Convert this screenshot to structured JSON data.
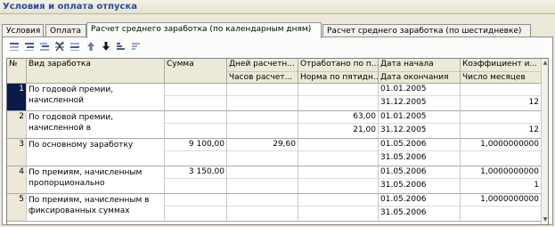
{
  "window": {
    "title": "Условия и оплата отпуска"
  },
  "tabs": [
    {
      "label": "Условия"
    },
    {
      "label": "Оплата"
    },
    {
      "label": "Расчет среднего заработка (по календарным дням)"
    },
    {
      "label": "Расчет среднего заработка (по шестидневке)"
    }
  ],
  "toolbar": {
    "buttons": [
      {
        "icon": "add-row-icon"
      },
      {
        "icon": "add-child-row-icon"
      },
      {
        "icon": "copy-row-icon"
      },
      {
        "icon": "delete-row-icon"
      },
      {
        "icon": "edit-row-icon"
      },
      {
        "icon": "move-up-icon"
      },
      {
        "icon": "move-down-icon"
      },
      {
        "icon": "sort-asc-icon"
      },
      {
        "icon": "sort-desc-icon"
      }
    ]
  },
  "table": {
    "columns": [
      {
        "l1": "№",
        "l2": ""
      },
      {
        "l1": "Вид заработка",
        "l2": ""
      },
      {
        "l1": "Сумма",
        "l2": ""
      },
      {
        "l1": "Дней расчетн...",
        "l2": "Часов расчет..."
      },
      {
        "l1": "Отработано по п...",
        "l2": "Норма по пятидн..."
      },
      {
        "l1": "Дата начала",
        "l2": "Дата окончания"
      },
      {
        "l1": "Коэффициент и...",
        "l2": "Число месяцев"
      }
    ],
    "rows": [
      {
        "num": "1",
        "name": "По годовой премии, начисленной",
        "sum": "",
        "days": "",
        "hours": "",
        "worked": "",
        "norm": "",
        "start": "01.01.2005",
        "end": "31.12.2005",
        "coef": "",
        "months": "12"
      },
      {
        "num": "2",
        "name": "По годовой премии, начисленной в",
        "sum": "",
        "days": "",
        "hours": "",
        "worked": "63,00",
        "norm": "21,00",
        "start": "01.01.2005",
        "end": "31.12.2005",
        "coef": "",
        "months": "12"
      },
      {
        "num": "3",
        "name": "По основному заработку",
        "sum": "9 100,00",
        "days": "29,60",
        "hours": "",
        "worked": "",
        "norm": "",
        "start": "01.05.2006",
        "end": "31.05.2006",
        "coef": "1,0000000000",
        "months": ""
      },
      {
        "num": "4",
        "name": "По премиям, начисленным пропорционально",
        "sum": "3 150,00",
        "days": "",
        "hours": "",
        "worked": "",
        "norm": "",
        "start": "01.05.2006",
        "end": "31.05.2006",
        "coef": "1,0000000000",
        "months": "1"
      },
      {
        "num": "5",
        "name": "По премиям, начисленным в фиксированных суммах",
        "sum": "",
        "days": "",
        "hours": "",
        "worked": "",
        "norm": "",
        "start": "01.05.2006",
        "end": "31.05.2006",
        "coef": "1,0000000000",
        "months": ""
      }
    ]
  },
  "colors": {
    "title": "#2c4a9a",
    "selected_row": "#0a1a4a",
    "header_bg": "#ece9d8"
  }
}
